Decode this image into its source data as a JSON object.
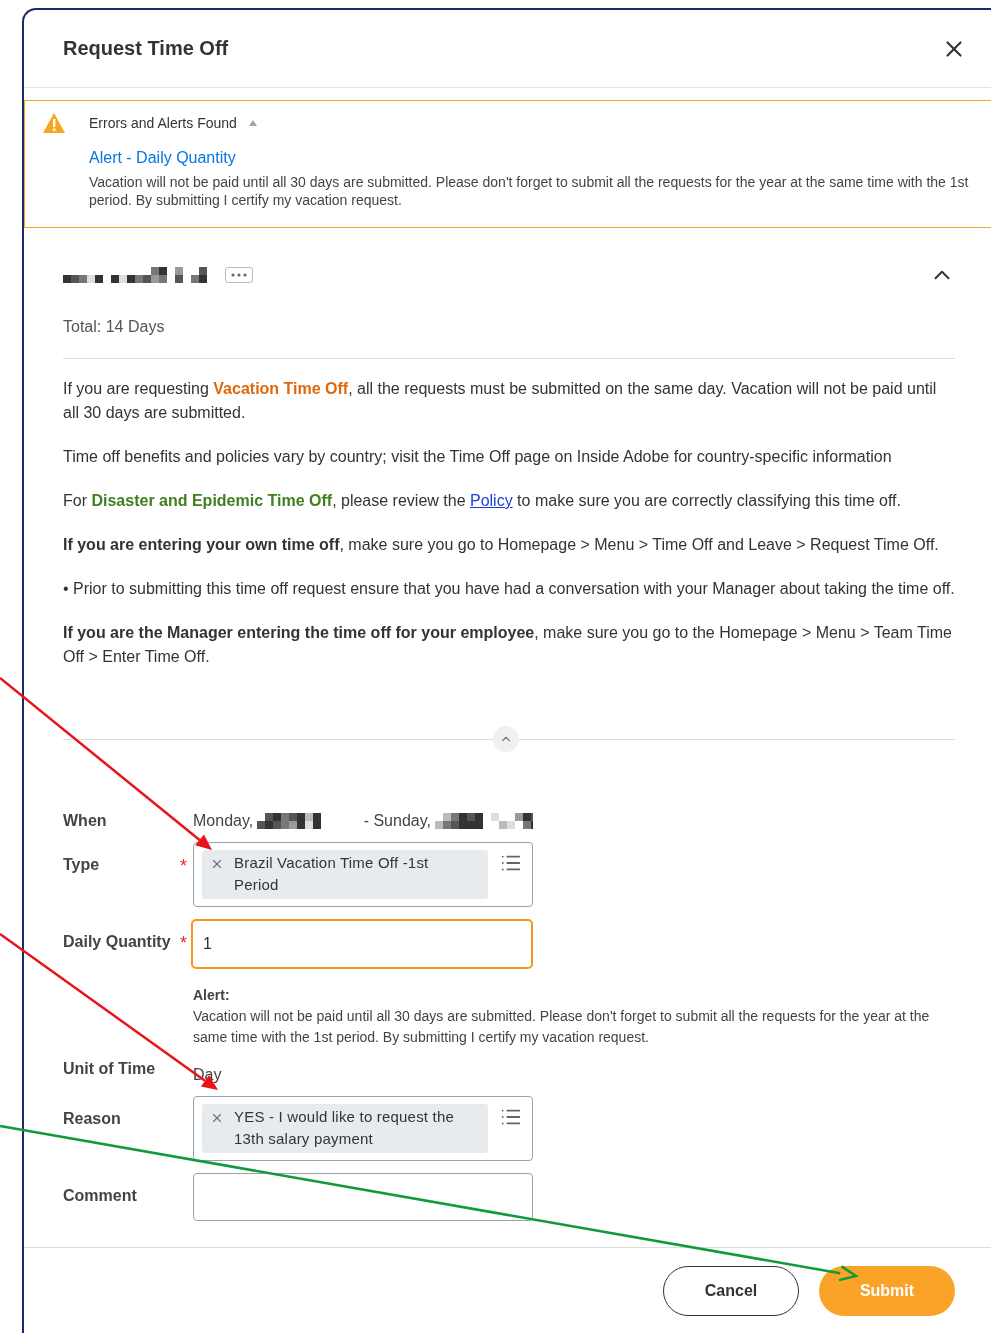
{
  "dialog": {
    "title": "Request Time Off"
  },
  "alerts_panel": {
    "heading": "Errors and Alerts Found",
    "expanded": true,
    "alerts": [
      {
        "title": "Alert - Daily Quantity",
        "message": "Vacation will not be paid until all 30 days are submitted. Please don't forget to submit all the requests for the year at the same time with the 1st period. By submitting I certify my vacation request."
      }
    ]
  },
  "request": {
    "expanded": true,
    "total": "Total: 14 Days",
    "instructions": [
      [
        {
          "kind": "plain",
          "text": "If you are requesting "
        },
        {
          "kind": "highlight",
          "text": "Vacation Time Off",
          "color": "#e0680c"
        },
        {
          "kind": "plain",
          "text": ", all the requests must be submitted on the same day. Vacation will not be paid until all 30 days are submitted."
        }
      ],
      [
        {
          "kind": "plain",
          "text": "Time off benefits and policies vary by country; visit the Time Off page on Inside Adobe for country-specific information"
        }
      ],
      [
        {
          "kind": "plain",
          "text": "For "
        },
        {
          "kind": "highlight",
          "text": "Disaster and Epidemic Time Off",
          "color": "#3f7f1e"
        },
        {
          "kind": "plain",
          "text": ", please review the "
        },
        {
          "kind": "link",
          "text": "Policy"
        },
        {
          "kind": "plain",
          "text": " to make sure you are correctly classifying this time off."
        }
      ],
      [
        {
          "kind": "bold",
          "text": "If you are entering your own time off"
        },
        {
          "kind": "plain",
          "text": ", make sure you go to Homepage > Menu > Time Off and Leave > Request Time Off."
        }
      ],
      [
        {
          "kind": "plain",
          "text": "• Prior to submitting this time off request ensure that you have had a conversation with your Manager about taking the time off."
        }
      ],
      [
        {
          "kind": "bold",
          "text": "If you are the Manager entering the time off for your employee"
        },
        {
          "kind": "plain",
          "text": ", make sure you go to the Homepage > Menu > Team Time Off > Enter Time Off."
        }
      ]
    ]
  },
  "form": {
    "required_mark": "*",
    "fields": [
      {
        "label": "When",
        "kind": "date_range",
        "required": false,
        "start": "Monday,",
        "end": "- Sunday,"
      },
      {
        "label": "Type",
        "kind": "multiselect",
        "required": true,
        "chips": [
          "Brazil Vacation Time Off -1st Period"
        ]
      },
      {
        "label": "Daily Quantity",
        "kind": "input",
        "required": true,
        "value": "1",
        "alert": {
          "title": "Alert:",
          "message": "Vacation will not be paid until all 30 days are submitted. Please don't forget to submit all the requests for the year at the same time with the 1st period. By submitting I certify my vacation request."
        }
      },
      {
        "label": "Unit of Time",
        "kind": "text",
        "required": false,
        "value": "Day"
      },
      {
        "label": "Reason",
        "kind": "multiselect",
        "required": false,
        "chips": [
          "YES - I would like to request the 13th salary payment"
        ]
      },
      {
        "label": "Comment",
        "kind": "textarea",
        "required": false
      }
    ]
  },
  "buttons": [
    {
      "label": "Cancel",
      "kind": "secondary"
    },
    {
      "label": "Submit",
      "kind": "primary"
    }
  ]
}
